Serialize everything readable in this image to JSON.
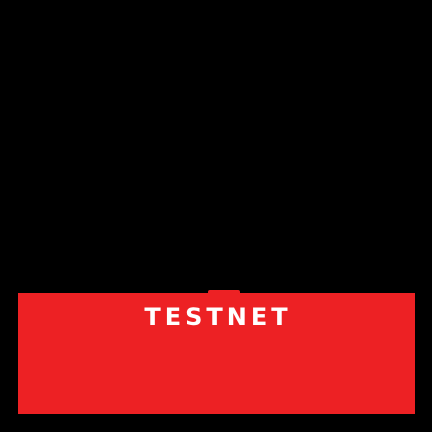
{
  "badge": {
    "label": "TESTNET",
    "background_color": "#000000",
    "banner_color": "#ED2124",
    "text_color": "#FFFFFF"
  }
}
